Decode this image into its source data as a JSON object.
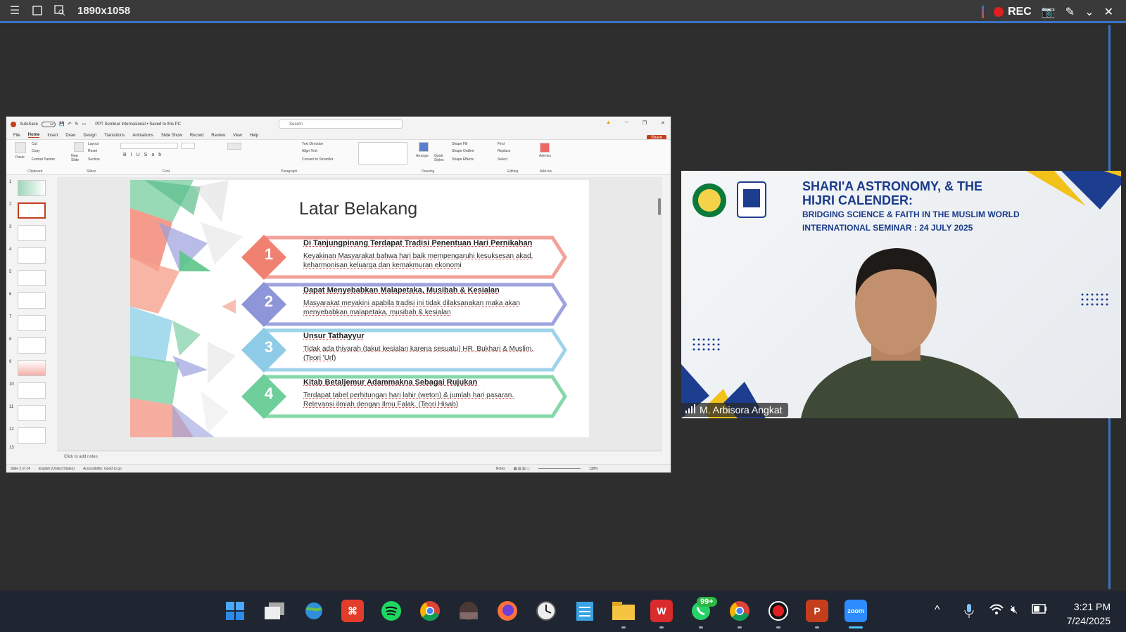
{
  "recorder": {
    "resolution": "1890x1058",
    "rec_label": "REC"
  },
  "ppt": {
    "autosave_label": "AutoSave",
    "autosave_state": "Off",
    "doc_title": "PPT Seminar Internasional • Saved to this PC",
    "search_placeholder": "Search",
    "menu": [
      "File",
      "Home",
      "Insert",
      "Draw",
      "Design",
      "Transitions",
      "Animations",
      "Slide Show",
      "Record",
      "Review",
      "View",
      "Help"
    ],
    "share_label": "Share",
    "ribbon": {
      "clipboard": {
        "paste": "Paste",
        "cut": "Cut",
        "copy": "Copy",
        "format_painter": "Format Painter",
        "group": "Clipboard"
      },
      "slides": {
        "new_slide": "New Slide",
        "layout": "Layout",
        "reset": "Reset",
        "section": "Section",
        "group": "Slides"
      },
      "font_group": "Font",
      "paragraph": {
        "text_direction": "Text Direction",
        "align_text": "Align Text",
        "convert": "Convert to SmartArt",
        "group": "Paragraph"
      },
      "drawing": {
        "arrange": "Arrange",
        "quick_styles": "Quick Styles",
        "shape_fill": "Shape Fill",
        "shape_outline": "Shape Outline",
        "shape_effects": "Shape Effects",
        "group": "Drawing"
      },
      "editing": {
        "find": "Find",
        "replace": "Replace",
        "select": "Select",
        "group": "Editing"
      },
      "addins": {
        "label": "Add-ins",
        "group": "Add-ins"
      }
    },
    "thumbnails": [
      "1",
      "2",
      "3",
      "4",
      "5",
      "6",
      "7",
      "8",
      "9",
      "10",
      "11",
      "12",
      "13"
    ],
    "notes_placeholder": "Click to add notes",
    "status": {
      "slide_info": "Slide 2 of 14",
      "language": "English (United States)",
      "accessibility": "Accessibility: Good to go",
      "notes": "Notes",
      "zoom": "138%"
    },
    "slide": {
      "title": "Latar Belakang",
      "points": [
        {
          "num": "1",
          "head": "Di Tanjungpinang Terdapat Tradisi Penentuan Hari Pernikahan",
          "body": "Keyakinan Masyarakat bahwa hari baik mempengaruhi kesuksesan akad, keharmonisan keluarga dan kemakmuran ekonomi",
          "color": "#f08070"
        },
        {
          "num": "2",
          "head": "Dapat Menyebabkan Malapetaka, Musibah & Kesialan",
          "body": "Masyarakat meyakini apabila tradisi ini tidak dilaksanakan maka akan menyebabkan malapetaka, musibah & kesialan",
          "color": "#8e95d8"
        },
        {
          "num": "3",
          "head": "Unsur Tathayyur",
          "body": "Tidak ada thiyarah (takut kesialan karena sesuatu) HR. Bukhari & Muslim. (Teori 'Urf)",
          "color": "#8ecbe6"
        },
        {
          "num": "4",
          "head": "Kitab Betaljemur Adammakna Sebagai Rujukan",
          "body": "Terdapat tabel perhitungan hari lahir (weton) & jumlah hari pasaran. Relevansi ilmiah dengan Ilmu Falak. (Teori Hisab)",
          "color": "#6fcf9a"
        }
      ]
    }
  },
  "video": {
    "title_line1": "SHARI'A ASTRONOMY, & THE",
    "title_line2": "HIJRI CALENDER:",
    "subtitle": "BRIDGING SCIENCE & FAITH IN THE MUSLIM WORLD",
    "date_line": "INTERNATIONAL SEMINAR : 24 JULY 2025",
    "participant_name": "M. Arbisora Angkat"
  },
  "taskbar": {
    "whatsapp_badge": "99+",
    "time": "3:21 PM",
    "date": "7/24/2025"
  },
  "colors": {
    "accent": "#3a74c9",
    "ppt_red": "#c43e1c",
    "seminar_blue": "#1a3a8a"
  }
}
